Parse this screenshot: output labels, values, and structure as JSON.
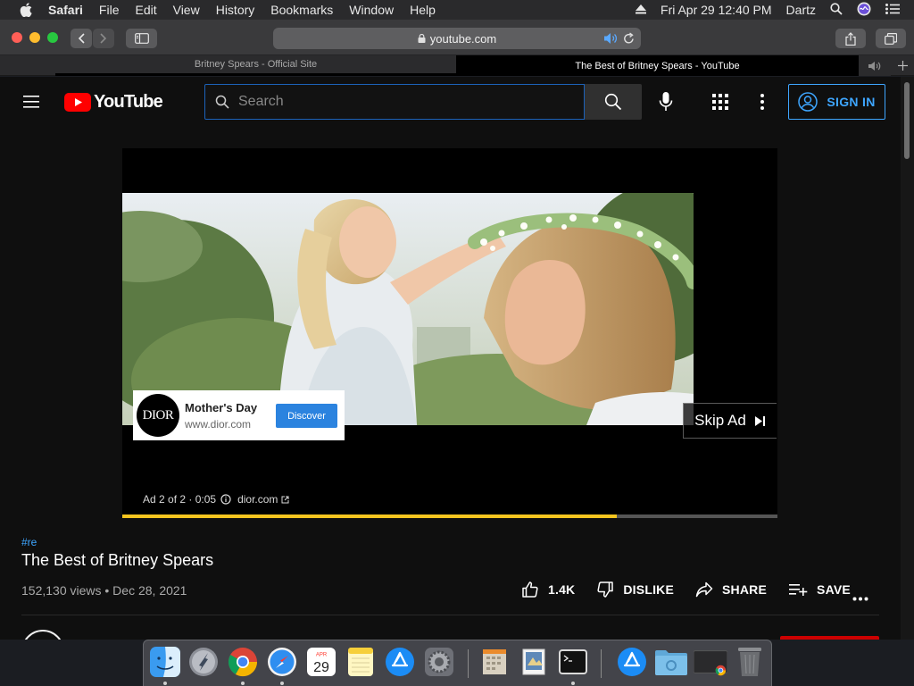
{
  "menubar": {
    "items": [
      "Safari",
      "File",
      "Edit",
      "View",
      "History",
      "Bookmarks",
      "Window",
      "Help"
    ],
    "datetime": "Fri Apr 29  12:40 PM",
    "user": "Dartz"
  },
  "browser": {
    "address": "youtube.com",
    "tabs": [
      {
        "title": "Britney Spears - Official Site",
        "active": false
      },
      {
        "title": "The Best of Britney Spears - YouTube",
        "active": true
      }
    ]
  },
  "youtube": {
    "logo_text": "YouTube",
    "search_placeholder": "Search",
    "signin_label": "SIGN IN"
  },
  "ad": {
    "advertiser_logo": "DIOR",
    "headline": "Mother's Day",
    "url": "www.dior.com",
    "cta": "Discover",
    "skip_label": "Skip Ad",
    "counter": "Ad 2 of 2 · 0:05",
    "link": "dior.com",
    "progress": 0.755,
    "progress_color": "#f4c51f"
  },
  "video": {
    "hashtag": "#re",
    "title": "The Best of Britney Spears",
    "stats": "152,130 views • Dec 28, 2021",
    "likes": "1.4K",
    "dislike_label": "DISLIKE",
    "share_label": "SHARE",
    "save_label": "SAVE"
  },
  "dock": {
    "apps": [
      "finder-icon",
      "launchpad-icon",
      "chrome-icon",
      "safari-icon",
      "calendar-icon",
      "notes-icon",
      "app-store-icon",
      "system-preferences-icon",
      "archive-icon",
      "preview-icon",
      "terminal-icon",
      "app-store-folder-icon",
      "folder-icon",
      "chrome-window-icon",
      "trash-icon"
    ],
    "calendar_month": "APR",
    "calendar_day": "29"
  },
  "colors": {
    "yt_red": "#ff0000",
    "link_blue": "#3ea6ff",
    "search_border": "#1c62b9",
    "discover_blue": "#2b83df"
  }
}
